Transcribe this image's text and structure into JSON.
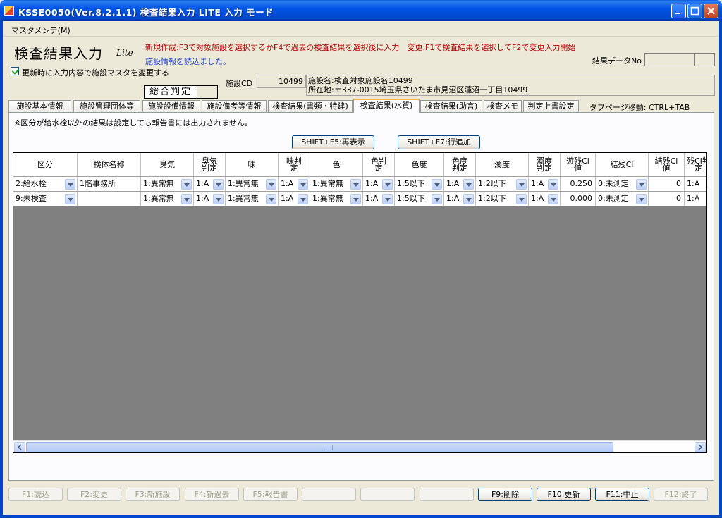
{
  "window": {
    "title": "KSSE0050(Ver.8.2.1.1) 検査結果入力 LITE 入力 モード",
    "minimize_icon": "minimize-icon",
    "maximize_icon": "maximize-icon",
    "close_icon": "close-icon"
  },
  "menu": {
    "items": [
      "マスタメンテ(M)"
    ]
  },
  "header": {
    "title": "検査結果入力",
    "title_sub": "Lite",
    "instruction": "新規作成:F3で対象施設を選択するかF4で過去の検査結果を選択後に入力　変更:F1で検査結果を選択してF2で変更入力開始",
    "status": "施設情報を読込ました。",
    "result_no_label": "結果データNo",
    "result_no_value": "",
    "result_no_sub": "",
    "update_master_label": "更新時に入力内容で施設マスタを変更する",
    "update_master_checked": true,
    "overall_judgement_label": "総合判定",
    "overall_judgement_value": "",
    "facility_cd_label": "施設CD",
    "facility_cd": "10499",
    "facility_name": "施設名:検査対象施設名10499",
    "facility_address": "所在地:〒337-0015埼玉県さいたま市見沼区蓮沼一丁目10499"
  },
  "tabs": [
    {
      "label": "施設基本情報",
      "active": false
    },
    {
      "label": "施設管理団体等",
      "active": false
    },
    {
      "label": "施設設備情報",
      "active": false
    },
    {
      "label": "施設備考等情報",
      "active": false
    },
    {
      "label": "検査結果(書類・特建)",
      "active": false
    },
    {
      "label": "検査結果(水質)",
      "active": true
    },
    {
      "label": "検査結果(助言)",
      "active": false
    },
    {
      "label": "検査メモ",
      "active": false
    },
    {
      "label": "判定上書設定",
      "active": false
    }
  ],
  "tab_hint": "タブページ移動: CTRL+TAB",
  "panel": {
    "notice": "※区分が給水栓以外の結果は設定しても報告書には出力されません。",
    "refresh_button": "SHIFT+F5:再表示",
    "add_row_button": "SHIFT+F7:行追加"
  },
  "grid": {
    "columns": [
      "区分",
      "検体名称",
      "臭気",
      "臭気\n判定",
      "味",
      "味判\n定",
      "色",
      "色判\n定",
      "色度",
      "色度\n判定",
      "濁度",
      "濁度\n判定",
      "遊残Cl\n値",
      "結残Cl",
      "結残Cl\n値",
      "残Cl判\n定"
    ],
    "rows": [
      [
        "2:給水栓",
        "1階事務所",
        "1:異常無",
        "1:A",
        "1:異常無",
        "1:A",
        "1:異常無",
        "1:A",
        "1:5以下",
        "1:A",
        "1:2以下",
        "1:A",
        "0.250",
        "0:未測定",
        "0",
        "1:A"
      ],
      [
        "9:未検査",
        "",
        "1:異常無",
        "1:A",
        "1:異常無",
        "1:A",
        "1:異常無",
        "1:A",
        "1:5以下",
        "1:A",
        "1:2以下",
        "1:A",
        "0.000",
        "0:未測定",
        "0",
        "1:A"
      ]
    ],
    "scroll_left_icon": "arrow-left-icon",
    "scroll_right_icon": "arrow-right-icon"
  },
  "function_keys": [
    {
      "label": "F1:読込",
      "enabled": false
    },
    {
      "label": "F2:変更",
      "enabled": false
    },
    {
      "label": "F3:新施設",
      "enabled": false
    },
    {
      "label": "F4:新過去",
      "enabled": false
    },
    {
      "label": "F5:報告書",
      "enabled": false
    },
    {
      "label": "",
      "enabled": false
    },
    {
      "label": "",
      "enabled": false
    },
    {
      "label": "",
      "enabled": false
    },
    {
      "label": "F9:削除",
      "enabled": true
    },
    {
      "label": "F10:更新",
      "enabled": true
    },
    {
      "label": "F11:中止",
      "enabled": true
    },
    {
      "label": "F12:終了",
      "enabled": false
    }
  ]
}
